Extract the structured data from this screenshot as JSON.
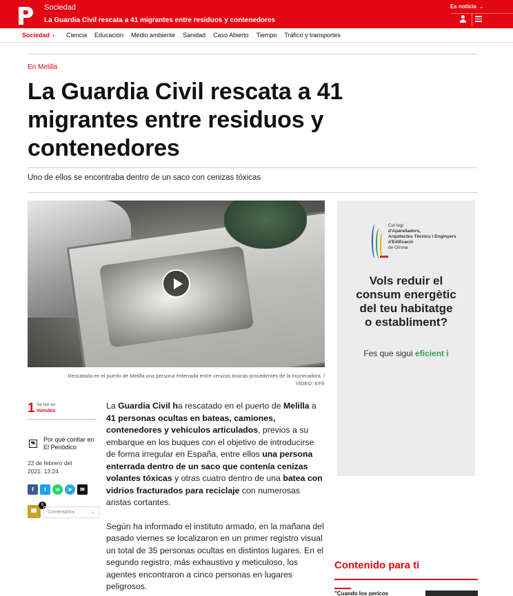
{
  "header": {
    "section": "Sociedad",
    "headline": "La Guardia Civil rescata a 41 migrantes entre residuos y contenedores",
    "es_noticia": "Es noticia",
    "brand_color": "#e30613"
  },
  "subnav": {
    "active": "Sociedad",
    "items": [
      "Ciencia",
      "Educación",
      "Medio ambiente",
      "Sanidad",
      "Caso Abierto",
      "Tiempo",
      "Tráfico y transportes"
    ]
  },
  "article": {
    "kicker": "En Melilla",
    "title": "La Guardia Civil rescata a 41 migrantes entre residuos y contenedores",
    "subtitle": "Uno de ellos se encontraba dentro de un saco con cenizas tóxicas",
    "caption": "Rescatada en el puerto de Melilla una persona enterrada entre cenizas tóxicas procedentes de la incineradora. /",
    "credit": "VÍDEO: EFE"
  },
  "meta": {
    "read_number": "1",
    "read_prefix": "Se lee en",
    "read_unit": "minutos",
    "trust_label": "Por qué confiar en El Periódico",
    "date_line1": "22 de febrero del",
    "date_line2": "2021. 13:24",
    "comments_count": "6",
    "comments_label": "Comentarios"
  },
  "ad": {
    "org_line1": "Col·legi",
    "org_line2": "d'Aparelladors,",
    "org_line3": "Arquitectes Tècnics i Enginyers d'Edificació",
    "org_line4": "de Girona",
    "slogan": [
      "Vols reduir el",
      "consum energètic",
      "del teu habitatge",
      "o establiment?"
    ],
    "cta_prefix": "Fes que sigui ",
    "cta_highlight": "eficient i"
  },
  "recommended": {
    "title": "Contenido para ti",
    "first_item": "\"Cuando los pericos"
  },
  "icons": {
    "logo": "el-periodico-logo",
    "user": "user-icon",
    "menu": "hamburger-menu-icon",
    "play": "play-icon"
  }
}
